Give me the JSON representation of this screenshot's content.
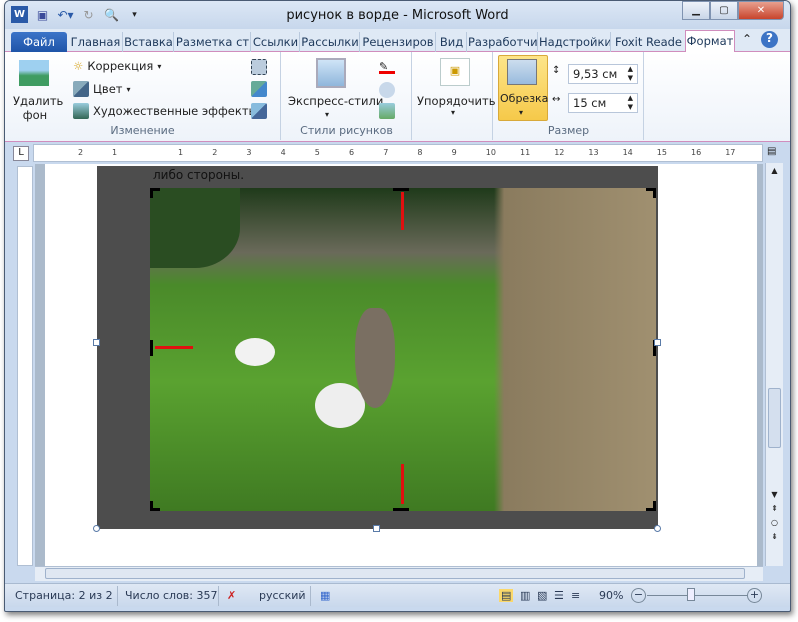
{
  "window": {
    "title": "рисунок в ворде - Microsoft Word"
  },
  "tabs": [
    "Файл",
    "Главная",
    "Вставка",
    "Разметка ст",
    "Ссылки",
    "Рассылки",
    "Рецензиров",
    "Вид",
    "Разработчи",
    "Надстройки",
    "Foxit Reade",
    "Формат"
  ],
  "ribbon": {
    "remove_bg": "Удалить фон",
    "correction": "Коррекция",
    "color": "Цвет",
    "art_effects": "Художественные эффекты",
    "group_change": "Изменение",
    "express_styles": "Экспресс-стили",
    "group_styles": "Стили рисунков",
    "arrange": "Упорядочить",
    "crop": "Обрезка",
    "height": "9,53 см",
    "width": "15 см",
    "group_size": "Размер"
  },
  "ruler": {
    "numbers": [
      "1",
      "2",
      "1",
      "2",
      "3",
      "4",
      "5",
      "6",
      "7",
      "8",
      "9",
      "10",
      "11",
      "12",
      "13",
      "14",
      "15",
      "16",
      "17"
    ]
  },
  "document": {
    "text": "либо стороны."
  },
  "status": {
    "page": "Страница: 2 из 2",
    "words": "Число слов: 357",
    "language": "русский",
    "zoom": "90%"
  }
}
